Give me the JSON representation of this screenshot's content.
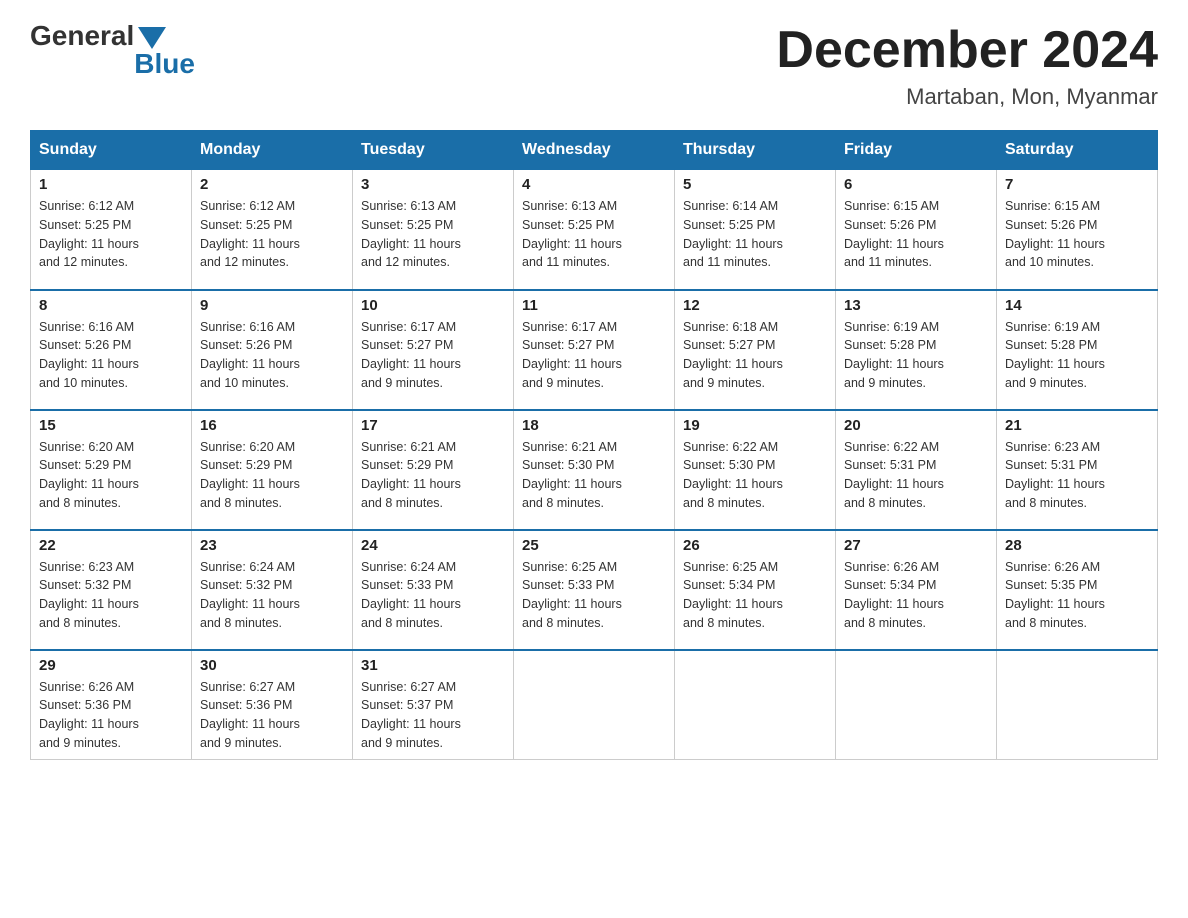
{
  "logo": {
    "general": "General",
    "blue": "Blue"
  },
  "title": "December 2024",
  "subtitle": "Martaban, Mon, Myanmar",
  "days_of_week": [
    "Sunday",
    "Monday",
    "Tuesday",
    "Wednesday",
    "Thursday",
    "Friday",
    "Saturday"
  ],
  "weeks": [
    [
      {
        "day": "1",
        "sunrise": "6:12 AM",
        "sunset": "5:25 PM",
        "daylight": "11 hours and 12 minutes."
      },
      {
        "day": "2",
        "sunrise": "6:12 AM",
        "sunset": "5:25 PM",
        "daylight": "11 hours and 12 minutes."
      },
      {
        "day": "3",
        "sunrise": "6:13 AM",
        "sunset": "5:25 PM",
        "daylight": "11 hours and 12 minutes."
      },
      {
        "day": "4",
        "sunrise": "6:13 AM",
        "sunset": "5:25 PM",
        "daylight": "11 hours and 11 minutes."
      },
      {
        "day": "5",
        "sunrise": "6:14 AM",
        "sunset": "5:25 PM",
        "daylight": "11 hours and 11 minutes."
      },
      {
        "day": "6",
        "sunrise": "6:15 AM",
        "sunset": "5:26 PM",
        "daylight": "11 hours and 11 minutes."
      },
      {
        "day": "7",
        "sunrise": "6:15 AM",
        "sunset": "5:26 PM",
        "daylight": "11 hours and 10 minutes."
      }
    ],
    [
      {
        "day": "8",
        "sunrise": "6:16 AM",
        "sunset": "5:26 PM",
        "daylight": "11 hours and 10 minutes."
      },
      {
        "day": "9",
        "sunrise": "6:16 AM",
        "sunset": "5:26 PM",
        "daylight": "11 hours and 10 minutes."
      },
      {
        "day": "10",
        "sunrise": "6:17 AM",
        "sunset": "5:27 PM",
        "daylight": "11 hours and 9 minutes."
      },
      {
        "day": "11",
        "sunrise": "6:17 AM",
        "sunset": "5:27 PM",
        "daylight": "11 hours and 9 minutes."
      },
      {
        "day": "12",
        "sunrise": "6:18 AM",
        "sunset": "5:27 PM",
        "daylight": "11 hours and 9 minutes."
      },
      {
        "day": "13",
        "sunrise": "6:19 AM",
        "sunset": "5:28 PM",
        "daylight": "11 hours and 9 minutes."
      },
      {
        "day": "14",
        "sunrise": "6:19 AM",
        "sunset": "5:28 PM",
        "daylight": "11 hours and 9 minutes."
      }
    ],
    [
      {
        "day": "15",
        "sunrise": "6:20 AM",
        "sunset": "5:29 PM",
        "daylight": "11 hours and 8 minutes."
      },
      {
        "day": "16",
        "sunrise": "6:20 AM",
        "sunset": "5:29 PM",
        "daylight": "11 hours and 8 minutes."
      },
      {
        "day": "17",
        "sunrise": "6:21 AM",
        "sunset": "5:29 PM",
        "daylight": "11 hours and 8 minutes."
      },
      {
        "day": "18",
        "sunrise": "6:21 AM",
        "sunset": "5:30 PM",
        "daylight": "11 hours and 8 minutes."
      },
      {
        "day": "19",
        "sunrise": "6:22 AM",
        "sunset": "5:30 PM",
        "daylight": "11 hours and 8 minutes."
      },
      {
        "day": "20",
        "sunrise": "6:22 AM",
        "sunset": "5:31 PM",
        "daylight": "11 hours and 8 minutes."
      },
      {
        "day": "21",
        "sunrise": "6:23 AM",
        "sunset": "5:31 PM",
        "daylight": "11 hours and 8 minutes."
      }
    ],
    [
      {
        "day": "22",
        "sunrise": "6:23 AM",
        "sunset": "5:32 PM",
        "daylight": "11 hours and 8 minutes."
      },
      {
        "day": "23",
        "sunrise": "6:24 AM",
        "sunset": "5:32 PM",
        "daylight": "11 hours and 8 minutes."
      },
      {
        "day": "24",
        "sunrise": "6:24 AM",
        "sunset": "5:33 PM",
        "daylight": "11 hours and 8 minutes."
      },
      {
        "day": "25",
        "sunrise": "6:25 AM",
        "sunset": "5:33 PM",
        "daylight": "11 hours and 8 minutes."
      },
      {
        "day": "26",
        "sunrise": "6:25 AM",
        "sunset": "5:34 PM",
        "daylight": "11 hours and 8 minutes."
      },
      {
        "day": "27",
        "sunrise": "6:26 AM",
        "sunset": "5:34 PM",
        "daylight": "11 hours and 8 minutes."
      },
      {
        "day": "28",
        "sunrise": "6:26 AM",
        "sunset": "5:35 PM",
        "daylight": "11 hours and 8 minutes."
      }
    ],
    [
      {
        "day": "29",
        "sunrise": "6:26 AM",
        "sunset": "5:36 PM",
        "daylight": "11 hours and 9 minutes."
      },
      {
        "day": "30",
        "sunrise": "6:27 AM",
        "sunset": "5:36 PM",
        "daylight": "11 hours and 9 minutes."
      },
      {
        "day": "31",
        "sunrise": "6:27 AM",
        "sunset": "5:37 PM",
        "daylight": "11 hours and 9 minutes."
      },
      null,
      null,
      null,
      null
    ]
  ],
  "labels": {
    "sunrise": "Sunrise:",
    "sunset": "Sunset:",
    "daylight": "Daylight:"
  }
}
